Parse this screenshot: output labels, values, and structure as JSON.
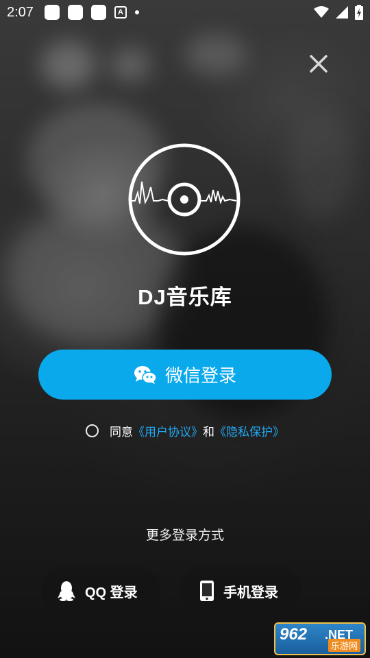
{
  "status_bar": {
    "time": "2:07",
    "a_icon": "A"
  },
  "app": {
    "name": "DJ音乐库"
  },
  "wechat_login": {
    "label": "微信登录",
    "icon": "wechat-icon",
    "color": "#0aa9ec"
  },
  "agreement": {
    "prefix": "同意",
    "user_agreement": "《用户协议》",
    "and": "和",
    "privacy": "《隐私保护》",
    "link_color": "#22a8f0"
  },
  "more_login": {
    "title": "更多登录方式",
    "options": [
      {
        "label": "QQ 登录",
        "icon": "qq-icon"
      },
      {
        "label": "手机登录",
        "icon": "phone-icon"
      }
    ]
  },
  "watermark": {
    "site": "962",
    "tld": ".NET",
    "name": "乐游网"
  }
}
